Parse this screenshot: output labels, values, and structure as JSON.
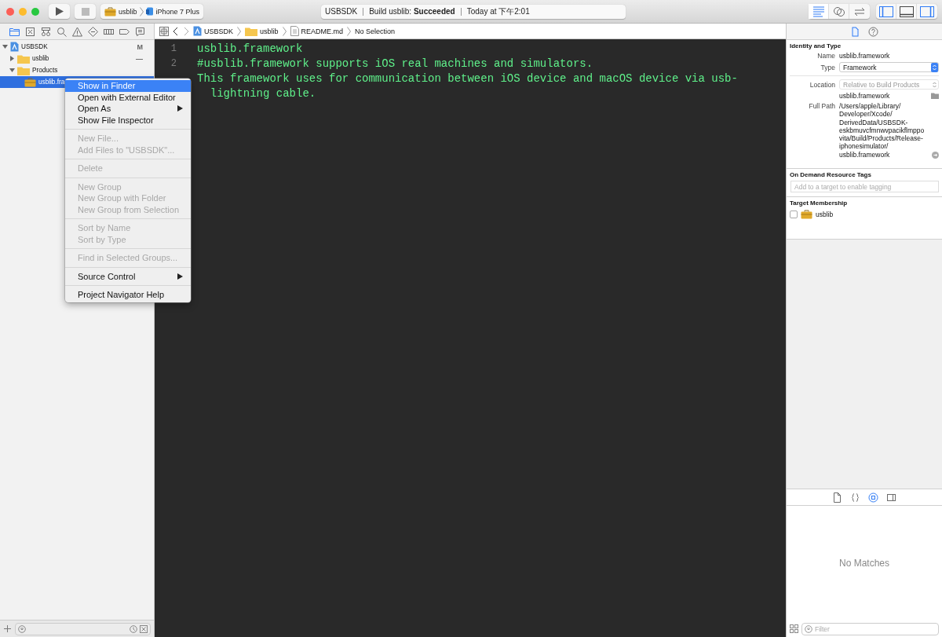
{
  "toolbar": {
    "scheme": "usblib",
    "destination": "iPhone 7 Plus",
    "activity": {
      "project": "USBSDK",
      "status": "Build usblib: **Succeeded**",
      "time": "Today at 下午2:01"
    },
    "editor_modes": [
      {
        "kind": "standard",
        "selected": true
      },
      {
        "kind": "assistant",
        "selected": false
      },
      {
        "kind": "version",
        "selected": false
      }
    ],
    "panels": [
      {
        "kind": "navigator",
        "on": true
      },
      {
        "kind": "debug",
        "on": false
      },
      {
        "kind": "utilities",
        "on": true
      }
    ]
  },
  "navigator": {
    "tabs": [
      {
        "kind": "project",
        "selected": true
      },
      {
        "kind": "source-control",
        "selected": false
      },
      {
        "kind": "symbol",
        "selected": false
      },
      {
        "kind": "find",
        "selected": false
      },
      {
        "kind": "issue",
        "selected": false
      },
      {
        "kind": "test",
        "selected": false
      },
      {
        "kind": "debug",
        "selected": false
      },
      {
        "kind": "breakpoint",
        "selected": false
      },
      {
        "kind": "report",
        "selected": false
      }
    ],
    "tree": [
      {
        "name": "USBSDK",
        "kind": "project",
        "badge": "M",
        "expanded": true,
        "selected": false,
        "children": [
          {
            "name": "usblib",
            "kind": "folder",
            "badge": "—",
            "expanded": false,
            "selected": false
          },
          {
            "name": "Products",
            "kind": "folder",
            "expanded": true,
            "selected": false,
            "children": [
              {
                "name": "usblib.fra",
                "kind": "framework",
                "selected": true
              }
            ]
          }
        ]
      }
    ]
  },
  "jump_bar": {
    "path": [
      {
        "name": "USBSDK",
        "kind": "project"
      },
      {
        "name": "usblib",
        "kind": "folder"
      },
      {
        "name": "README.md",
        "kind": "file"
      },
      {
        "name": "No Selection",
        "kind": "none"
      }
    ]
  },
  "editor": {
    "lines": [
      {
        "number": "1",
        "text": "usblib.framework"
      },
      {
        "number": "2",
        "text": "#usblib.framework supports iOS real machines and simulators."
      },
      {
        "text": "This framework uses for communication between iOS device and macOS device via usb-lightning cable."
      }
    ]
  },
  "context_menu": {
    "groups": [
      {
        "items": [
          {
            "label": "Show in Finder",
            "selected": true,
            "disabled": false,
            "submenu": false
          },
          {
            "label": "Open with External Editor",
            "selected": false,
            "disabled": false,
            "submenu": false
          },
          {
            "label": "Open As",
            "selected": false,
            "disabled": false,
            "submenu": true
          },
          {
            "label": "Show File Inspector",
            "selected": false,
            "disabled": false,
            "submenu": false
          }
        ]
      },
      {
        "items": [
          {
            "label": "New File...",
            "selected": false,
            "disabled": true,
            "submenu": false
          },
          {
            "label": "Add Files to \"USBSDK\"...",
            "selected": false,
            "disabled": true,
            "submenu": false
          }
        ]
      },
      {
        "items": [
          {
            "label": "Delete",
            "selected": false,
            "disabled": true,
            "submenu": false
          }
        ]
      },
      {
        "items": [
          {
            "label": "New Group",
            "selected": false,
            "disabled": true,
            "submenu": false
          },
          {
            "label": "New Group with Folder",
            "selected": false,
            "disabled": true,
            "submenu": false
          },
          {
            "label": "New Group from Selection",
            "selected": false,
            "disabled": true,
            "submenu": false
          }
        ]
      },
      {
        "items": [
          {
            "label": "Sort by Name",
            "selected": false,
            "disabled": true,
            "submenu": false
          },
          {
            "label": "Sort by Type",
            "selected": false,
            "disabled": true,
            "submenu": false
          }
        ]
      },
      {
        "items": [
          {
            "label": "Find in Selected Groups...",
            "selected": false,
            "disabled": true,
            "submenu": false
          }
        ]
      },
      {
        "items": [
          {
            "label": "Source Control",
            "selected": false,
            "disabled": false,
            "submenu": true
          }
        ]
      },
      {
        "items": [
          {
            "label": "Project Navigator Help",
            "selected": false,
            "disabled": false,
            "submenu": false
          }
        ]
      }
    ]
  },
  "inspector": {
    "tabs": [
      {
        "kind": "file",
        "selected": true
      },
      {
        "kind": "help",
        "selected": false
      }
    ],
    "identity": {
      "title": "Identity and Type",
      "name_label": "Name",
      "name": "usblib.framework",
      "type_label": "Type",
      "type": "Framework",
      "location_label": "Location",
      "location": "Relative to Build Products",
      "location_file": "usblib.framework",
      "full_path_label": "Full Path",
      "full_path": "/Users/apple/Library/Developer/Xcode/DerivedData/USBSDK-eskbmuvcfmnwvpacikflmppovita/Build/Products/Release-iphonesimulator/usblib.framework"
    },
    "tags": {
      "title": "On Demand Resource Tags",
      "placeholder": "Add to a target to enable tagging"
    },
    "membership": {
      "title": "Target Membership",
      "targets": [
        {
          "name": "usblib",
          "checked": false
        }
      ]
    }
  },
  "library": {
    "tabs": [
      {
        "kind": "file",
        "selected": false
      },
      {
        "kind": "snippet",
        "selected": false
      },
      {
        "kind": "object",
        "selected": true
      },
      {
        "kind": "media",
        "selected": false
      }
    ],
    "empty_text": "No Matches",
    "filter_placeholder": "Filter"
  }
}
